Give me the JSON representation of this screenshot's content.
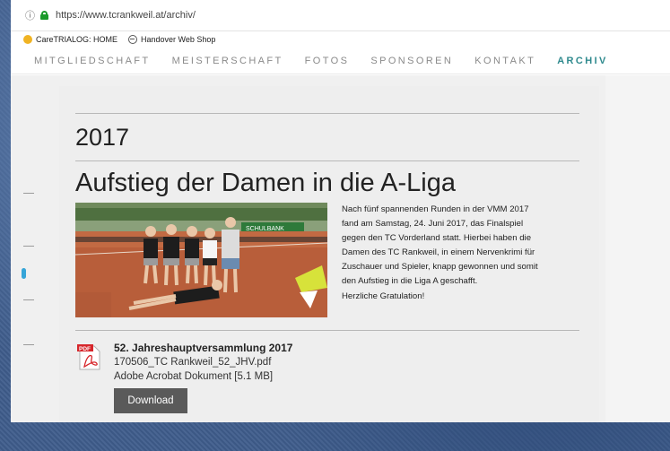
{
  "browser": {
    "url": "https://www.tcrankweil.at/archiv/"
  },
  "bookmarks": [
    {
      "label": "CareTRIALOG: HOME"
    },
    {
      "label": "Handover Web Shop"
    }
  ],
  "nav": [
    {
      "label": "MITGLIEDSCHAFT"
    },
    {
      "label": "MEISTERSCHAFT"
    },
    {
      "label": "FOTOS"
    },
    {
      "label": "SPONSOREN"
    },
    {
      "label": "KONTAKT"
    },
    {
      "label": "ARCHIV"
    }
  ],
  "archive": {
    "year": "2017",
    "article": {
      "title": "Aufstieg der Damen in die A-Liga",
      "body_lines": [
        "Nach fünf spannenden Runden in der VMM 2017",
        "fand am Samstag, 24. Juni 2017, das Finalspiel",
        "gegen den TC Vorderland statt. Hierbei haben die",
        "Damen des TC Rankweil, in einem Nervenkrimi für",
        "Zuschauer und Spieler, knapp gewonnen und somit",
        "den Aufstieg in die Liga A geschafft.",
        "Herzliche Gratulation!"
      ],
      "photo_banner_text": "SCHULBANK"
    },
    "document": {
      "icon_label": "PDF",
      "title": "52. Jahreshauptversammlung 2017",
      "filename": "170506_TC Rankweil_52_JHV.pdf",
      "type": "Adobe Acrobat Dokument [5.1 MB]",
      "download_label": "Download"
    }
  },
  "colors": {
    "nav_active": "#2f8a8e",
    "nav_inactive": "#8a8a8a",
    "button_bg": "#5a5a5a",
    "pdf_red": "#d6262b"
  }
}
